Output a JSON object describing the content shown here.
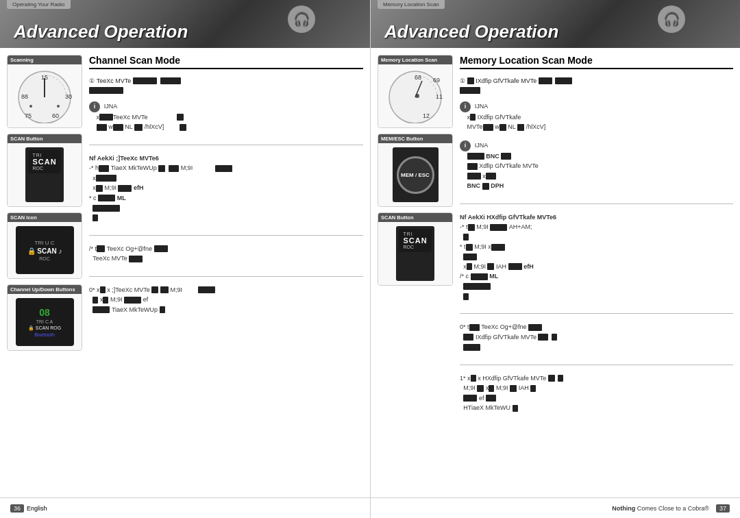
{
  "left_page": {
    "header": {
      "tab_label": "Operating Your Radio",
      "title": "Advanced Operation",
      "icon": "🎧"
    },
    "section_title": "Channel Scan Mode",
    "sidebar": {
      "items": [
        {
          "label": "Scanning",
          "type": "dial",
          "numbers": [
            "15",
            "30",
            "60",
            "75",
            "88"
          ]
        },
        {
          "label": "SCAN Button",
          "type": "scan_button"
        },
        {
          "label": "SCAN Icon",
          "type": "scan_icon"
        },
        {
          "label": "Channel Up/Down Buttons",
          "type": "channel_buttons"
        }
      ]
    },
    "content": {
      "intro_line1": "TeeXc MVTe",
      "intro_redacted": "████ █████",
      "instruction_blocks": [
        {
          "step": "",
          "icon": "i",
          "lines": [
            "IJNA",
            "x████TeeXc MVTe",
            "██ w█NL █/hlXcV]"
          ]
        },
        {
          "step": "Nf AekXi ;]TeeXc MVTe6",
          "substeps": [
            "- * h█TiaeX MkTeWUp █ ██M;9I   █",
            "  x████",
            "  x█M;9I  ████efH",
            "* c █████ML",
            "  ████████",
            "  █"
          ]
        },
        {
          "step": "/* t█TeeXc Og+@fne      ██",
          "lines": [
            "TeeXc MVTe      ██"
          ]
        },
        {
          "step": "0* x███x ;]TeeXc MVTe █ ██M;9I   █",
          "lines": [
            "█ x█M;9I     ████ef",
            "████ TiaeX MkTeWUp █"
          ]
        }
      ]
    }
  },
  "right_page": {
    "header": {
      "tab_label": "Memory Location Scan",
      "title": "Advanced Operation",
      "icon": "🎧"
    },
    "section_title": "Memory Location Scan Mode",
    "sidebar": {
      "items": [
        {
          "label": "Memory Location Scan",
          "type": "mem_dial",
          "numbers": [
            "68",
            "69",
            "11",
            "12"
          ]
        },
        {
          "label": "MEM/ESC Button",
          "type": "mem_esc"
        },
        {
          "label": "SCAN Button",
          "type": "scan_button"
        }
      ]
    },
    "content": {
      "intro_line1": "IXdfip GfVTkafe MVTe",
      "intro_redacted": "████ █████",
      "instruction_blocks": [
        {
          "step": "",
          "icon": "i",
          "lines": [
            "IJNA",
            "x█IXdfip GfVTkafe",
            "MVTe██ w█NL █/hlXcV]"
          ]
        },
        {
          "step": "",
          "icon": "i",
          "lines": [
            "IJNA",
            "█████BNC ██",
            "███ █Xdfip GfVTkafe MVTe",
            "████ x███",
            "BNC ██ █DPH"
          ]
        },
        {
          "step": "Nf AekXi HXdfip GfVTkafe MVTe6",
          "substeps": [
            "- * t█M;9I   █████AH+AM;",
            "  █",
            "* t█M;9I       x████",
            "  ████",
            "  x█M;9I  █IAH    ████efH",
            "/* c █████ML",
            "  ████████",
            "  █"
          ]
        },
        {
          "step": "0* t██TeeXc Og+@fne      ██",
          "lines": [
            "██IXdfip GfVTkafe MVTe     █",
            "████"
          ]
        },
        {
          "step": "1* x███x HXdfip GfVTkafe MVTe █ ██",
          "lines": [
            "M;9I  ██ x█M;9I   █IAH   █",
            "████ef ████",
            "HTiaeX MkTeWU█"
          ]
        }
      ]
    }
  },
  "footer": {
    "left_page_number": "36",
    "left_language": "English",
    "right_page_number": "37",
    "right_tagline": "Nothing Comes Close to a Cobra®"
  }
}
